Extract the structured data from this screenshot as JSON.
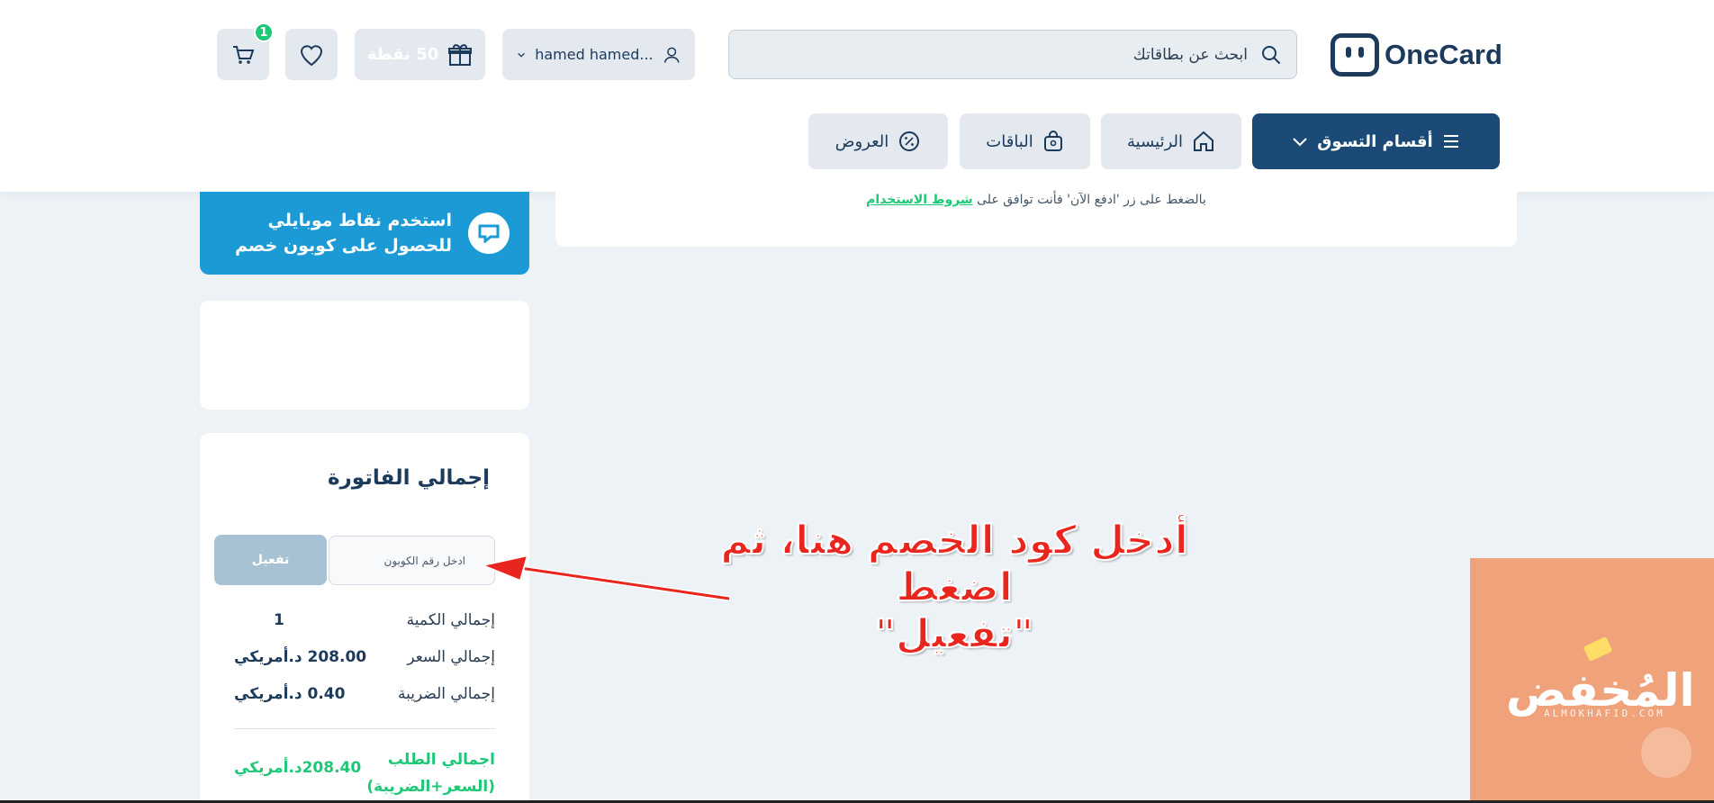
{
  "header": {
    "logo_text": "OneCard",
    "search_placeholder": "ابحث عن بطاقاتك",
    "user_name": "hamed hamed...",
    "points_label": "50 نقطة",
    "cart_count": "1"
  },
  "nav": {
    "shop": "أقسام التسوق",
    "home": "الرئيسية",
    "packages": "الباقات",
    "offers": "العروض"
  },
  "terms": {
    "prefix": "بالضغط على زر 'ادفع الآن' فأنت توافق على",
    "link": "شروط الاستخدام"
  },
  "mobily": {
    "line1": "استخدم نقاط موبايلي",
    "line2": "للحصول على كوبون خصم"
  },
  "invoice": {
    "title": "إجمالي الفاتورة",
    "coupon_placeholder": "ادخل رقم الكوبون",
    "activate_label": "تفعيل",
    "qty_label": "إجمالي الكمية",
    "qty_value": "1",
    "price_label": "إجمالي السعر",
    "price_value": "208.00 د.أمريكي",
    "tax_label": "إجمالي الضريبة",
    "tax_value": "0.40 د.أمريكي",
    "total_label": "اجمالي الطلب (السعر+الضريبة)",
    "total_value": "208.40د.أمريكي"
  },
  "annotation": {
    "line1": "أدخل كود الخصم هنا، ثم اضغط",
    "line2": "\"تفعيل\""
  },
  "watermark": {
    "text": "المُخفض",
    "sub": "ALMOKHAFID.COM"
  },
  "colors": {
    "primary": "#1a4a75",
    "accent_green": "#1fc878",
    "mobily_blue": "#1b9ad6",
    "annotation_red": "#e8261d"
  }
}
